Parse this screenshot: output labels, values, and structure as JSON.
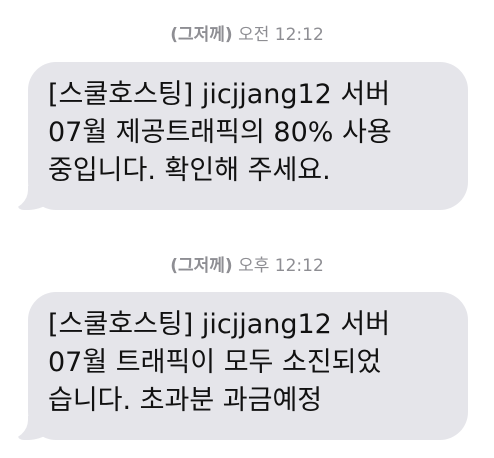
{
  "messages": [
    {
      "timestamp_day": "(그저께)",
      "timestamp_time": "오전 12:12",
      "lines": [
        "[스쿨호스팅] jicjjang12 서버",
        "07월 제공트래픽의 80% 사용",
        "중입니다. 확인해 주세요."
      ]
    },
    {
      "timestamp_day": "(그저께)",
      "timestamp_time": "오후 12:12",
      "lines": [
        "[스쿨호스팅] jicjjang12 서버",
        "07월 트래픽이 모두 소진되었",
        "습니다. 초과분 과금예정"
      ]
    }
  ],
  "colors": {
    "bubble": "#e5e5ea",
    "timestamp": "#8e8e93",
    "text": "#111111"
  }
}
